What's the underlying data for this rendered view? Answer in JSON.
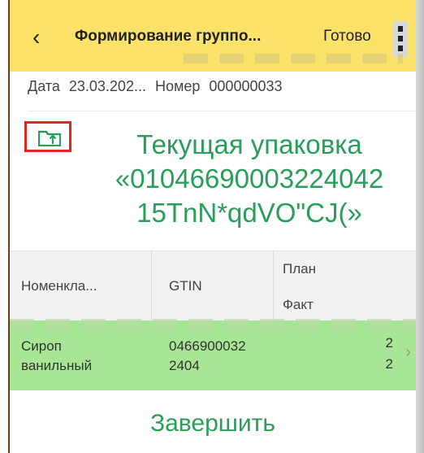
{
  "header": {
    "back_icon": "chevron-left-icon",
    "title": "Формирование группо...",
    "done_label": "Готово",
    "menu_icon": "more-vertical-icon"
  },
  "info": {
    "date_label": "Дата",
    "date_value": "23.03.202...",
    "number_label": "Номер",
    "number_value": "000000033"
  },
  "toolbar": {
    "upload_icon": "folder-upload-icon"
  },
  "package": {
    "line1": "Текущая упаковка",
    "line2": "«01046690003224042",
    "line3": "15TnN*qdVO\"CJ(»"
  },
  "table": {
    "columns": {
      "nomenclature": "Номенкла...",
      "gtin": "GTIN",
      "plan": "План",
      "fact": "Факт"
    },
    "rows": [
      {
        "name_line1": "Сироп",
        "name_line2": "ванильный",
        "gtin_line1": "0466900032",
        "gtin_line2": "2404",
        "plan": "2",
        "fact": "2"
      }
    ]
  },
  "footer": {
    "finish_label": "Завершить"
  },
  "colors": {
    "header_bg": "#fbe36a",
    "accent_green": "#2a9d5a",
    "row_highlight": "#a8e695",
    "highlight_border": "#e0261f"
  }
}
